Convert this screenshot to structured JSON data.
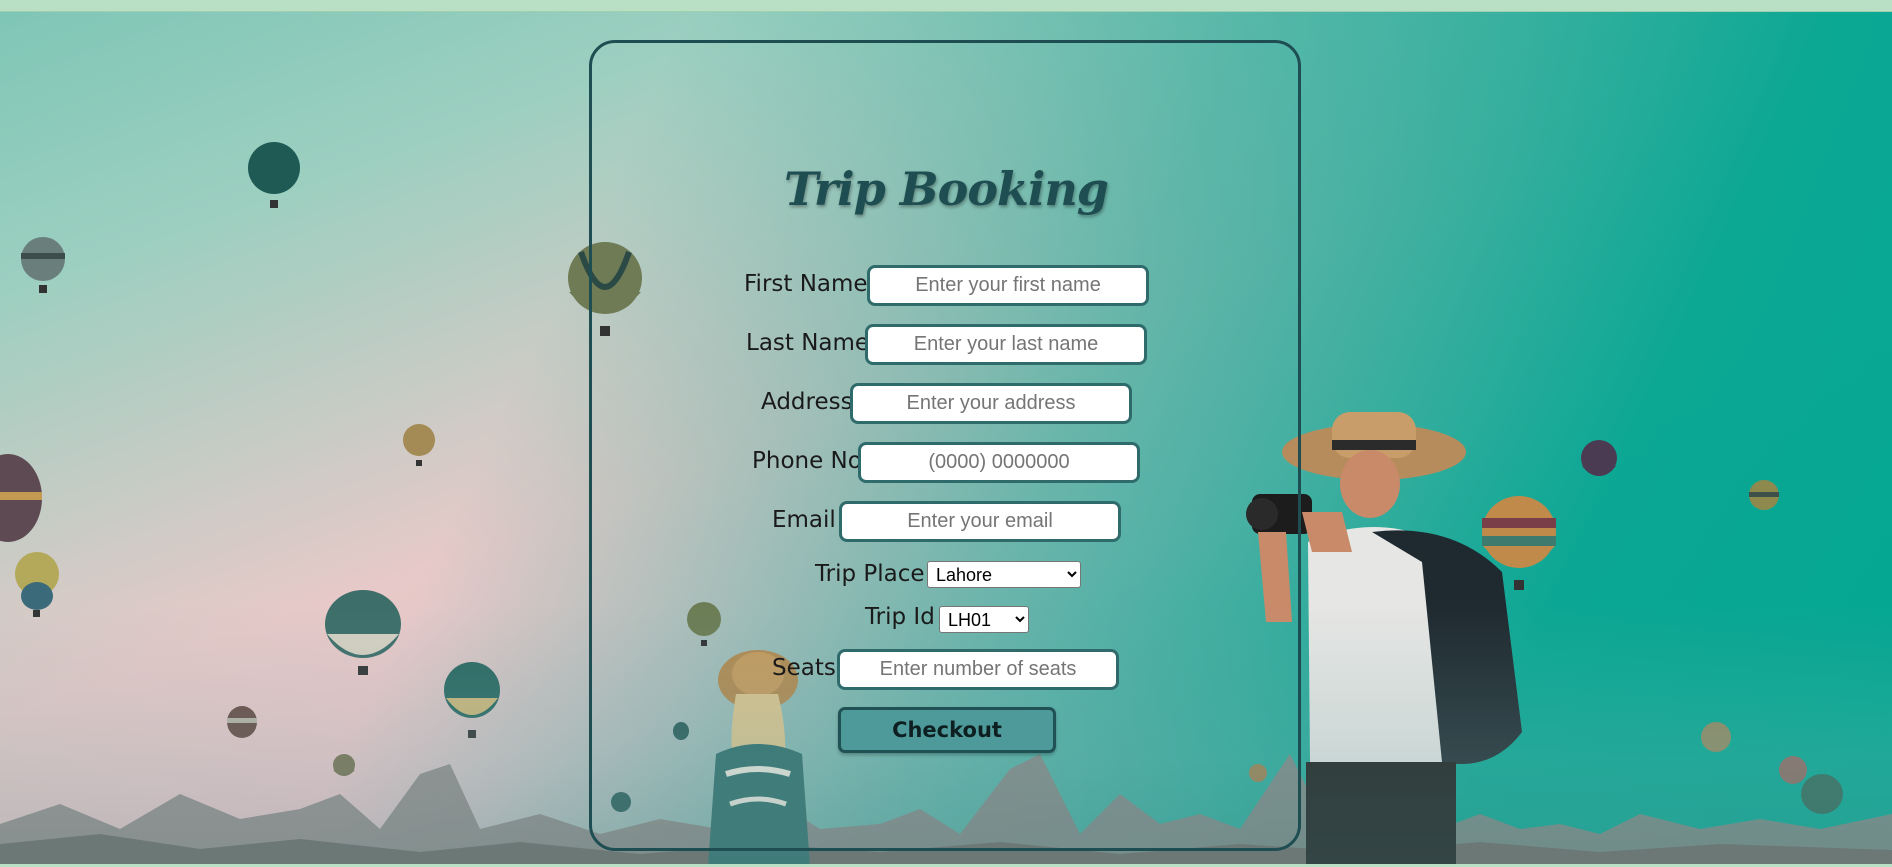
{
  "form": {
    "title": "Trip Booking",
    "first_name": {
      "label": "First Name",
      "placeholder": "Enter your first name"
    },
    "last_name": {
      "label": "Last Name",
      "placeholder": "Enter your last name"
    },
    "address": {
      "label": "Address",
      "placeholder": "Enter your address"
    },
    "phone": {
      "label": "Phone No",
      "placeholder": "(0000) 0000000"
    },
    "email": {
      "label": "Email",
      "placeholder": "Enter your email"
    },
    "trip_place": {
      "label": "Trip Place",
      "selected": "Lahore"
    },
    "trip_id": {
      "label": "Trip Id",
      "selected": "LH01"
    },
    "seats": {
      "label": "Seats",
      "placeholder": "Enter number of seats"
    },
    "checkout_label": "Checkout"
  },
  "colors": {
    "accent": "#4e9a9a",
    "border": "#1e4d52",
    "title": "#1f4e52",
    "sky_teal": "#03a792",
    "sky_pink": "#f0c6cc"
  }
}
